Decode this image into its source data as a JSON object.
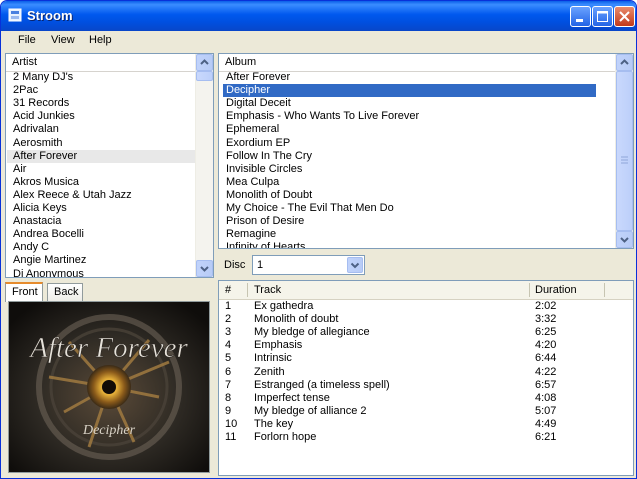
{
  "window": {
    "title": "Stroom"
  },
  "menu": [
    "File",
    "View",
    "Help"
  ],
  "artists": {
    "header": "Artist",
    "items": [
      "2 Many DJ's",
      "2Pac",
      "31 Records",
      "Acid Junkies",
      "Adrivalan",
      "Aerosmith",
      "After Forever",
      "Air",
      "Akros Musica",
      "Alex Reece & Utah Jazz",
      "Alicia Keys",
      "Anastacia",
      "Andrea Bocelli",
      "Andy C",
      "Angie Martinez",
      "Dj Anonymous"
    ],
    "selected": "After Forever",
    "partial_top": "2 Many DJ's"
  },
  "albums": {
    "header": "Album",
    "items": [
      "After Forever",
      "Decipher",
      "Digital Deceit",
      "Emphasis - Who Wants To Live Forever",
      "Ephemeral",
      "Exordium EP",
      "Follow In The Cry",
      "Invisible Circles",
      "Mea Culpa",
      "Monolith of Doubt",
      "My Choice - The Evil That Men Do",
      "Prison of Desire",
      "Remagine",
      "Infinity of Hearts"
    ],
    "selected": "Decipher"
  },
  "cover": {
    "tabs": [
      "Front",
      "Back"
    ],
    "active_tab": "Front",
    "band_text": "After Forever",
    "album_text": "Decipher"
  },
  "disc": {
    "label": "Disc",
    "value": "1"
  },
  "tracks": {
    "columns": [
      "#",
      "Track",
      "Duration"
    ],
    "rows": [
      {
        "n": "1",
        "title": "Ex gathedra",
        "dur": "2:02"
      },
      {
        "n": "2",
        "title": "Monolith of doubt",
        "dur": "3:32"
      },
      {
        "n": "3",
        "title": "My bledge of allegiance",
        "dur": "6:25"
      },
      {
        "n": "4",
        "title": "Emphasis",
        "dur": "4:20"
      },
      {
        "n": "5",
        "title": "Intrinsic",
        "dur": "6:44"
      },
      {
        "n": "6",
        "title": "Zenith",
        "dur": "4:22"
      },
      {
        "n": "7",
        "title": "Estranged (a timeless spell)",
        "dur": "6:57"
      },
      {
        "n": "8",
        "title": "Imperfect tense",
        "dur": "4:08"
      },
      {
        "n": "9",
        "title": "My bledge of alliance 2",
        "dur": "5:07"
      },
      {
        "n": "10",
        "title": "The key",
        "dur": "4:49"
      },
      {
        "n": "11",
        "title": "Forlorn hope",
        "dur": "6:21"
      }
    ]
  },
  "colors": {
    "titlebar": "#0058ee",
    "selection": "#316ac5",
    "window_bg": "#ece9d8"
  }
}
